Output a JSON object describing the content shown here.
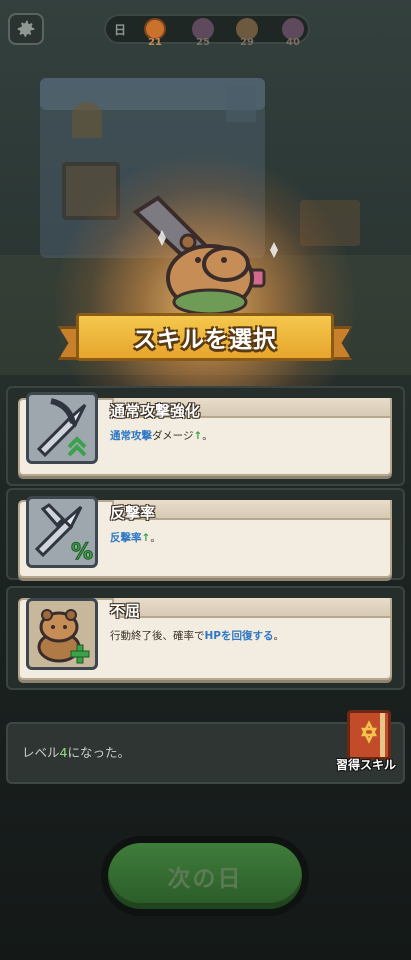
{
  "topbar": {
    "day_label": "日",
    "day_milestones": [
      {
        "number": "21",
        "icon": "crossed-swords-icon",
        "state": "current"
      },
      {
        "number": "25",
        "icon": "skull-icon",
        "state": "upcoming"
      },
      {
        "number": "29",
        "icon": "skull-icon",
        "state": "upcoming"
      },
      {
        "number": "40",
        "icon": "skull-icon",
        "state": "upcoming"
      }
    ]
  },
  "banner": {
    "title": "スキルを選択"
  },
  "skills": [
    {
      "name": "通常攻撃強化",
      "icon": "sword-upgrade-icon",
      "desc_parts": [
        {
          "text": "通常攻撃",
          "style": "blue"
        },
        {
          "text": "ダメージ",
          "style": "plain"
        },
        {
          "text": "↑",
          "style": "green"
        },
        {
          "text": "。",
          "style": "plain"
        }
      ]
    },
    {
      "name": "反撃率",
      "icon": "counter-sword-percent-icon",
      "desc_parts": [
        {
          "text": "反撃率",
          "style": "blue"
        },
        {
          "text": "↑",
          "style": "green"
        },
        {
          "text": "。",
          "style": "plain"
        }
      ]
    },
    {
      "name": "不屈",
      "icon": "capybara-heal-icon",
      "desc_parts": [
        {
          "text": "行動終了後、確率で",
          "style": "plain"
        },
        {
          "text": "HPを回復する",
          "style": "blue"
        },
        {
          "text": "。",
          "style": "plain"
        }
      ]
    }
  ],
  "log": {
    "prefix": "レベル",
    "level": "4",
    "suffix": "になった。"
  },
  "learned_skills": {
    "label": "習得スキル"
  },
  "next_day": {
    "label": "次の日"
  },
  "colors": {
    "accent_gold": "#f5c84e",
    "button_green": "#3f7d3a",
    "highlight_blue": "#2f78c6",
    "highlight_green": "#3aa24a"
  }
}
